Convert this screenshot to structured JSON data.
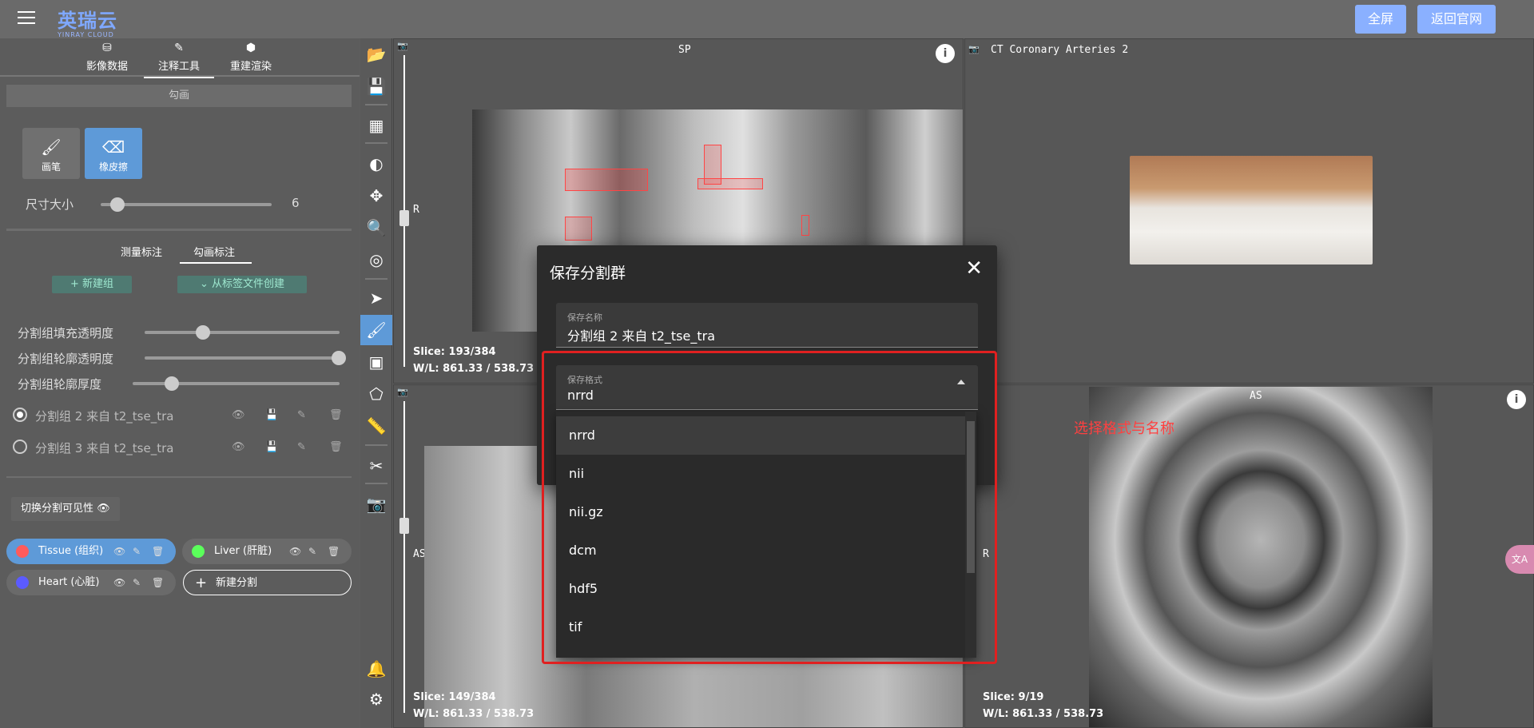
{
  "header": {
    "logo_text": "英瑞云",
    "logo_sub": "YINRAY CLOUD",
    "fullscreen_label": "全屏",
    "back_label": "返回官网"
  },
  "left_panel": {
    "tabs": [
      {
        "label": "影像数据",
        "icon": "database-icon"
      },
      {
        "label": "注释工具",
        "icon": "pen-icon"
      },
      {
        "label": "重建渲染",
        "icon": "cube-icon"
      }
    ],
    "section_title": "勾画",
    "tools": [
      {
        "label": "画笔",
        "icon": "brush-icon"
      },
      {
        "label": "橡皮擦",
        "icon": "eraser-icon"
      }
    ],
    "size_label": "尺寸大小",
    "size_value": "6",
    "subtabs": [
      {
        "label": "测量标注"
      },
      {
        "label": "勾画标注"
      }
    ],
    "new_group_label": "+ 新建组",
    "from_label_file_label": "从标签文件创建",
    "fill_opacity_label": "分割组填充透明度",
    "outline_opacity_label": "分割组轮廓透明度",
    "outline_thickness_label": "分割组轮廓厚度",
    "groups": [
      {
        "name": "分割组 2 来自 t2_tse_tra",
        "selected": true
      },
      {
        "name": "分割组 3 来自 t2_tse_tra",
        "selected": false
      }
    ],
    "toggle_visibility_label": "切换分割可见性",
    "segments": [
      {
        "name": "Tissue (组织)",
        "color": "#ff5b5b"
      },
      {
        "name": "Liver (肝脏)",
        "color": "#5bff5b"
      },
      {
        "name": "Heart (心脏)",
        "color": "#5b5bff"
      }
    ],
    "new_segment_label": "新建分割"
  },
  "viewports": {
    "top_left": {
      "orientation": "SP",
      "side": "R",
      "slice": "Slice: 193/384",
      "wl": "W/L: 861.33 / 538.73"
    },
    "top_right": {
      "title": "CT Coronary Arteries 2"
    },
    "bottom_left": {
      "side": "AS",
      "slice": "Slice: 149/384",
      "wl": "W/L: 861.33 / 538.73"
    },
    "bottom_right": {
      "orientation": "AS",
      "side": "R",
      "slice": "Slice: 9/19",
      "wl": "W/L: 861.33 / 538.73"
    }
  },
  "dialog": {
    "title": "保存分割群",
    "name_label": "保存名称",
    "name_value": "分割组 2 来自 t2_tse_tra",
    "format_label": "保存格式",
    "format_value": "nrrd",
    "options": [
      "nrrd",
      "nii",
      "nii.gz",
      "dcm",
      "hdf5",
      "tif"
    ]
  },
  "annotation_text": "选择格式与名称",
  "translate_label": "文A"
}
